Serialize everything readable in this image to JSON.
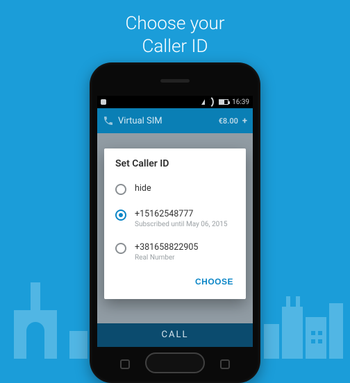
{
  "promo": {
    "line1": "Choose your",
    "line2": "Caller ID"
  },
  "statusbar": {
    "time": "16:39"
  },
  "app": {
    "title": "Virtual SIM",
    "balance": "€8.00",
    "call_button": "CALL"
  },
  "dialog": {
    "title": "Set Caller ID",
    "choose_label": "CHOOSE",
    "options": [
      {
        "primary": "hide",
        "secondary": "",
        "selected": false
      },
      {
        "primary": "+15162548777",
        "secondary": "Subscribed until May 06, 2015",
        "selected": true
      },
      {
        "primary": "+381658822905",
        "secondary": "Real Number",
        "selected": false
      }
    ]
  }
}
